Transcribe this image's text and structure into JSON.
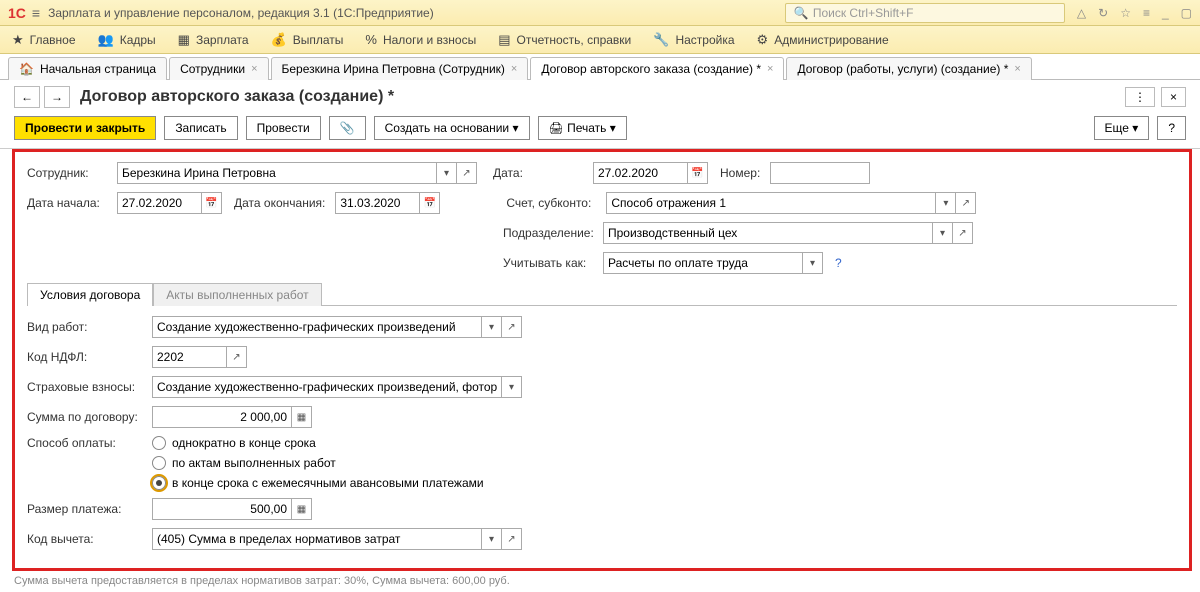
{
  "app": {
    "title": "Зарплата и управление персоналом, редакция 3.1  (1С:Предприятие)",
    "search_placeholder": "Поиск Ctrl+Shift+F"
  },
  "menu": {
    "main": "Главное",
    "hr": "Кадры",
    "salary": "Зарплата",
    "payments": "Выплаты",
    "taxes": "Налоги и взносы",
    "reports": "Отчетность, справки",
    "settings": "Настройка",
    "admin": "Администрирование"
  },
  "tabs": {
    "home": "Начальная страница",
    "employees": "Сотрудники",
    "employee": "Березкина Ирина Петровна (Сотрудник)",
    "author": "Договор авторского заказа (создание) *",
    "work": "Договор (работы, услуги) (создание) *"
  },
  "page": {
    "title": "Договор авторского заказа (создание) *"
  },
  "toolbar": {
    "post_close": "Провести и закрыть",
    "save": "Записать",
    "post": "Провести",
    "create_based": "Создать на основании",
    "print": "Печать",
    "more": "Еще"
  },
  "form": {
    "employee_lbl": "Сотрудник:",
    "employee": "Березкина Ирина Петровна",
    "date_lbl": "Дата:",
    "date": "27.02.2020",
    "number_lbl": "Номер:",
    "number": "",
    "start_lbl": "Дата начала:",
    "start": "27.02.2020",
    "end_lbl": "Дата окончания:",
    "end": "31.03.2020",
    "account_lbl": "Счет, субконто:",
    "account": "Способ отражения 1",
    "dept_lbl": "Подразделение:",
    "dept": "Производственный цех",
    "consider_lbl": "Учитывать как:",
    "consider": "Расчеты по оплате труда",
    "tab1": "Условия договора",
    "tab2": "Акты выполненных работ",
    "work_type_lbl": "Вид работ:",
    "work_type": "Создание художественно-графических произведений",
    "ndfl_lbl": "Код НДФЛ:",
    "ndfl": "2202",
    "ins_lbl": "Страховые взносы:",
    "ins": "Создание художественно-графических произведений, фотораб(",
    "sum_lbl": "Сумма по договору:",
    "sum": "2 000,00",
    "pay_method_lbl": "Способ оплаты:",
    "pay1": "однократно в конце срока",
    "pay2": "по актам выполненных работ",
    "pay3": "в конце срока с ежемесячными авансовыми платежами",
    "pay_size_lbl": "Размер платежа:",
    "pay_size": "500,00",
    "ded_lbl": "Код вычета:",
    "ded": "(405) Сумма в пределах нормативов затрат"
  },
  "footer": "Сумма вычета предоставляется в пределах нормативов затрат: 30%,  Сумма вычета: 600,00 руб."
}
